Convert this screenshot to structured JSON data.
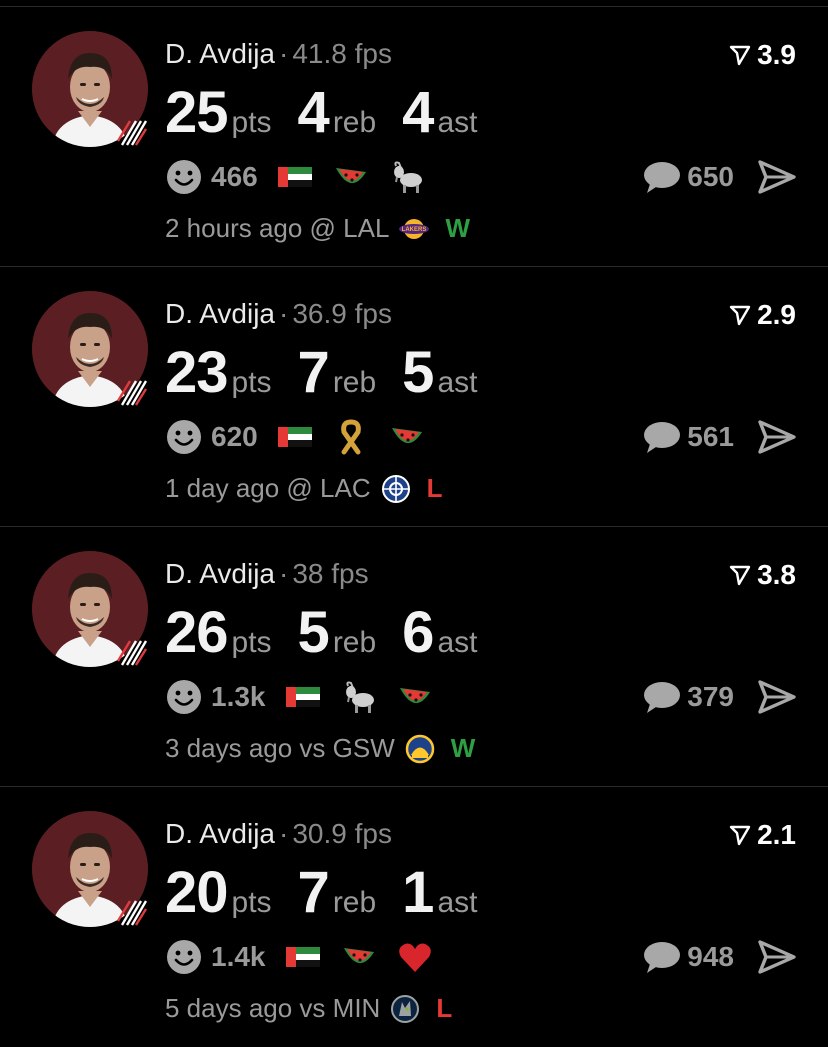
{
  "colors": {
    "win": "#2ea043",
    "loss": "#e53935",
    "muted": "#9a9a9a"
  },
  "posts": [
    {
      "player": "D. Avdija",
      "sep": "·",
      "fps": "41.8 fps",
      "rating": "3.9",
      "pts": "25",
      "pts_label": "pts",
      "reb": "4",
      "reb_label": "reb",
      "ast": "4",
      "ast_label": "ast",
      "reaction_count": "466",
      "reactions": [
        "uae-flag-icon",
        "watermelon-icon",
        "goat-icon"
      ],
      "comments": "650",
      "time": "2 hours ago @ LAL",
      "opponent_icon": "lakers-logo-icon",
      "result": "W"
    },
    {
      "player": "D. Avdija",
      "sep": "·",
      "fps": "36.9 fps",
      "rating": "2.9",
      "pts": "23",
      "pts_label": "pts",
      "reb": "7",
      "reb_label": "reb",
      "ast": "5",
      "ast_label": "ast",
      "reaction_count": "620",
      "reactions": [
        "uae-flag-icon",
        "ribbon-icon",
        "watermelon-icon"
      ],
      "comments": "561",
      "time": "1 day ago @ LAC",
      "opponent_icon": "clippers-logo-icon",
      "result": "L"
    },
    {
      "player": "D. Avdija",
      "sep": "·",
      "fps": "38 fps",
      "rating": "3.8",
      "pts": "26",
      "pts_label": "pts",
      "reb": "5",
      "reb_label": "reb",
      "ast": "6",
      "ast_label": "ast",
      "reaction_count": "1.3k",
      "reactions": [
        "uae-flag-icon",
        "goat-icon",
        "watermelon-icon"
      ],
      "comments": "379",
      "time": "3 days ago vs GSW",
      "opponent_icon": "warriors-logo-icon",
      "result": "W"
    },
    {
      "player": "D. Avdija",
      "sep": "·",
      "fps": "30.9 fps",
      "rating": "2.1",
      "pts": "20",
      "pts_label": "pts",
      "reb": "7",
      "reb_label": "reb",
      "ast": "1",
      "ast_label": "ast",
      "reaction_count": "1.4k",
      "reactions": [
        "uae-flag-icon",
        "watermelon-icon",
        "heart-icon"
      ],
      "comments": "948",
      "time": "5 days ago vs MIN",
      "opponent_icon": "timberwolves-logo-icon",
      "result": "L"
    }
  ]
}
